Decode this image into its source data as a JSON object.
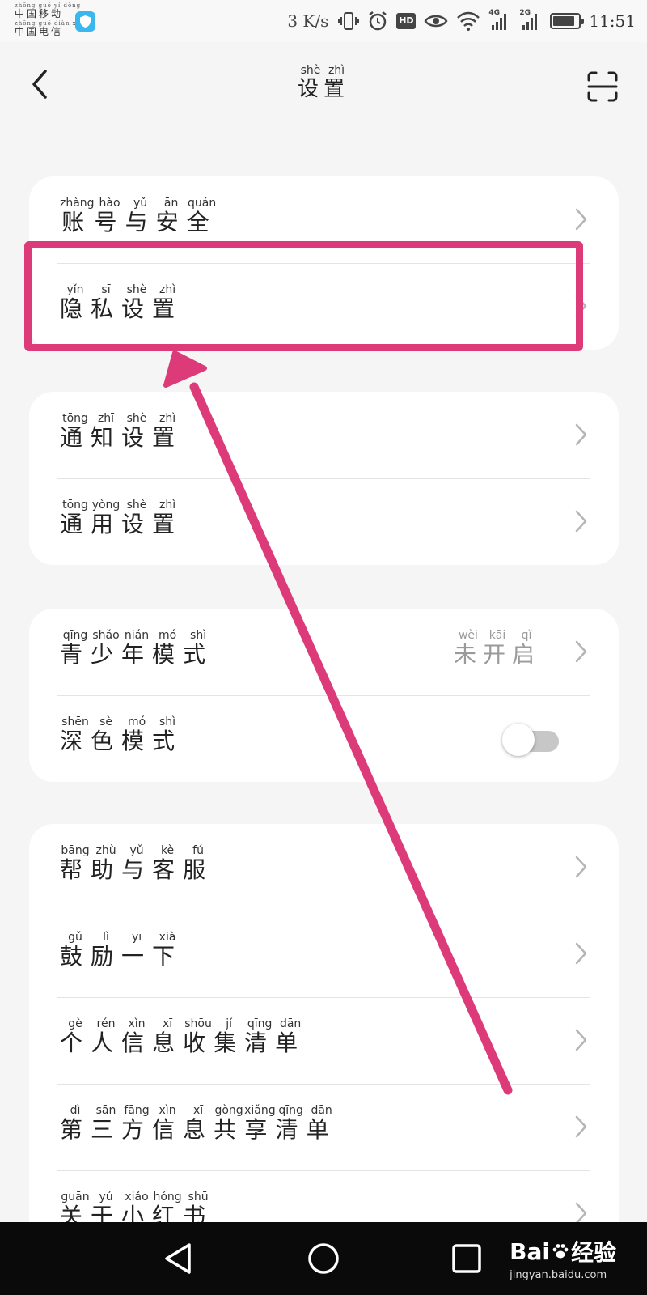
{
  "status_bar": {
    "carrier_1": {
      "pinyin": "zhōng guó yí dòng",
      "text": "中国移动"
    },
    "carrier_2": {
      "pinyin": "zhōng guó diàn xìn",
      "text": "中国电信"
    },
    "speed": "3 K/s",
    "network_1": "4G",
    "network_2": "2G",
    "hd": "HD",
    "time": "11:51"
  },
  "header": {
    "title": [
      {
        "char": "设",
        "py": "shè"
      },
      {
        "char": "置",
        "py": "zhì"
      }
    ]
  },
  "groups": [
    {
      "rows": [
        {
          "label": [
            {
              "char": "账",
              "py": "zhàng"
            },
            {
              "char": "号",
              "py": "hào"
            },
            {
              "char": "与",
              "py": "yǔ"
            },
            {
              "char": "安",
              "py": "ān"
            },
            {
              "char": "全",
              "py": "quán"
            }
          ],
          "accessory": "chevron"
        },
        {
          "label": [
            {
              "char": "隐",
              "py": "yǐn"
            },
            {
              "char": "私",
              "py": "sī"
            },
            {
              "char": "设",
              "py": "shè"
            },
            {
              "char": "置",
              "py": "zhì"
            }
          ],
          "accessory": "chevron"
        }
      ]
    },
    {
      "rows": [
        {
          "label": [
            {
              "char": "通",
              "py": "tōng"
            },
            {
              "char": "知",
              "py": "zhī"
            },
            {
              "char": "设",
              "py": "shè"
            },
            {
              "char": "置",
              "py": "zhì"
            }
          ],
          "accessory": "chevron"
        },
        {
          "label": [
            {
              "char": "通",
              "py": "tōng"
            },
            {
              "char": "用",
              "py": "yòng"
            },
            {
              "char": "设",
              "py": "shè"
            },
            {
              "char": "置",
              "py": "zhì"
            }
          ],
          "accessory": "chevron"
        }
      ]
    },
    {
      "rows": [
        {
          "label": [
            {
              "char": "青",
              "py": "qīng"
            },
            {
              "char": "少",
              "py": "shǎo"
            },
            {
              "char": "年",
              "py": "nián"
            },
            {
              "char": "模",
              "py": "mó"
            },
            {
              "char": "式",
              "py": "shì"
            }
          ],
          "accessory": "chevron",
          "value": [
            {
              "char": "未",
              "py": "wèi"
            },
            {
              "char": "开",
              "py": "kāi"
            },
            {
              "char": "启",
              "py": "qǐ"
            }
          ]
        },
        {
          "label": [
            {
              "char": "深",
              "py": "shēn"
            },
            {
              "char": "色",
              "py": "sè"
            },
            {
              "char": "模",
              "py": "mó"
            },
            {
              "char": "式",
              "py": "shì"
            }
          ],
          "accessory": "toggle",
          "toggle_on": false
        }
      ]
    },
    {
      "rows": [
        {
          "label": [
            {
              "char": "帮",
              "py": "bāng"
            },
            {
              "char": "助",
              "py": "zhù"
            },
            {
              "char": "与",
              "py": "yǔ"
            },
            {
              "char": "客",
              "py": "kè"
            },
            {
              "char": "服",
              "py": "fú"
            }
          ],
          "accessory": "chevron"
        },
        {
          "label": [
            {
              "char": "鼓",
              "py": "gǔ"
            },
            {
              "char": "励",
              "py": "lì"
            },
            {
              "char": "一",
              "py": "yī"
            },
            {
              "char": "下",
              "py": "xià"
            }
          ],
          "accessory": "chevron"
        },
        {
          "label": [
            {
              "char": "个",
              "py": "gè"
            },
            {
              "char": "人",
              "py": "rén"
            },
            {
              "char": "信",
              "py": "xìn"
            },
            {
              "char": "息",
              "py": "xī"
            },
            {
              "char": "收",
              "py": "shōu"
            },
            {
              "char": "集",
              "py": "jí"
            },
            {
              "char": "清",
              "py": "qīng"
            },
            {
              "char": "单",
              "py": "dān"
            }
          ],
          "accessory": "chevron"
        },
        {
          "label": [
            {
              "char": "第",
              "py": "dì"
            },
            {
              "char": "三",
              "py": "sān"
            },
            {
              "char": "方",
              "py": "fāng"
            },
            {
              "char": "信",
              "py": "xìn"
            },
            {
              "char": "息",
              "py": "xī"
            },
            {
              "char": "共",
              "py": "gòng"
            },
            {
              "char": "享",
              "py": "xiǎng"
            },
            {
              "char": "清",
              "py": "qīng"
            },
            {
              "char": "单",
              "py": "dān"
            }
          ],
          "accessory": "chevron"
        },
        {
          "label": [
            {
              "char": "关",
              "py": "guān"
            },
            {
              "char": "于",
              "py": "yú"
            },
            {
              "char": "小",
              "py": "xiǎo"
            },
            {
              "char": "红",
              "py": "hóng"
            },
            {
              "char": "书",
              "py": "shū"
            }
          ],
          "accessory": "chevron"
        }
      ]
    }
  ],
  "annotation": {
    "color": "#dc3a78",
    "highlighted_row": "隐私设置"
  },
  "watermark": {
    "main_left": "Bai",
    "main_right": "经验",
    "sub": "jingyan.baidu.com"
  },
  "icons": {
    "back": "chevron-left-icon",
    "scan": "scan-icon",
    "row_arrow": "chevron-right-icon",
    "nav_back": "triangle-back-icon",
    "nav_home": "circle-home-icon",
    "nav_recent": "square-recent-icon"
  }
}
